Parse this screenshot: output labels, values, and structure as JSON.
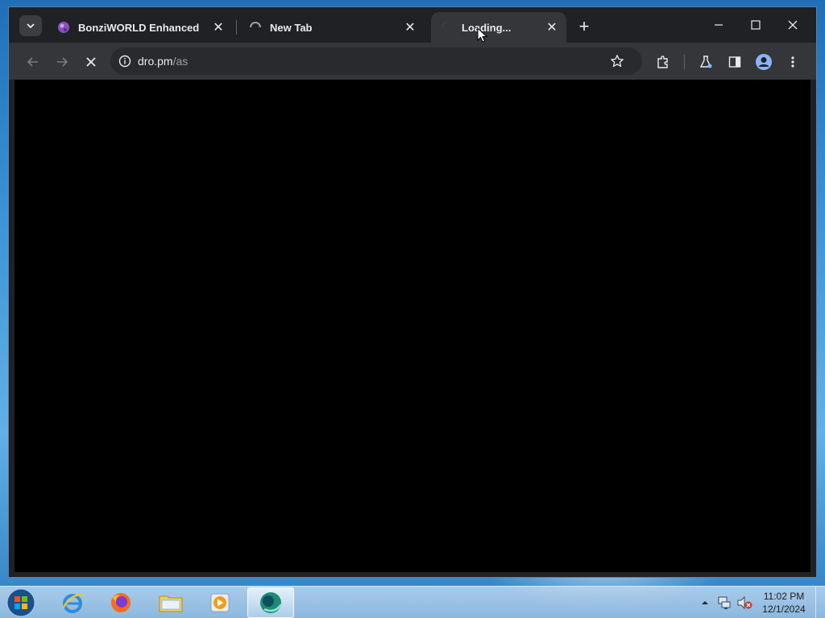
{
  "browser": {
    "tabs": [
      {
        "title": "BonziWORLD Enhanced",
        "icon": "bonzi-favicon",
        "close": "✕"
      },
      {
        "title": "New Tab",
        "icon": "loading-spinner",
        "close": "✕"
      },
      {
        "title": "Loading...",
        "icon": "loading-spinner",
        "close": "✕"
      }
    ],
    "new_tab_label": "+",
    "omnibox": {
      "host": "dro.pm",
      "path": "/as"
    }
  },
  "taskbar": {
    "apps": [
      "start-orb",
      "internet-explorer",
      "firefox",
      "file-explorer",
      "media-player",
      "bonzi-app"
    ],
    "clock": {
      "time": "11:02 PM",
      "date": "12/1/2024"
    }
  },
  "colors": {
    "tabstrip": "#202124",
    "toolbar": "#35363a",
    "omnibox": "#282a2d",
    "content": "#000000",
    "avatar": "#8ab4f8"
  }
}
